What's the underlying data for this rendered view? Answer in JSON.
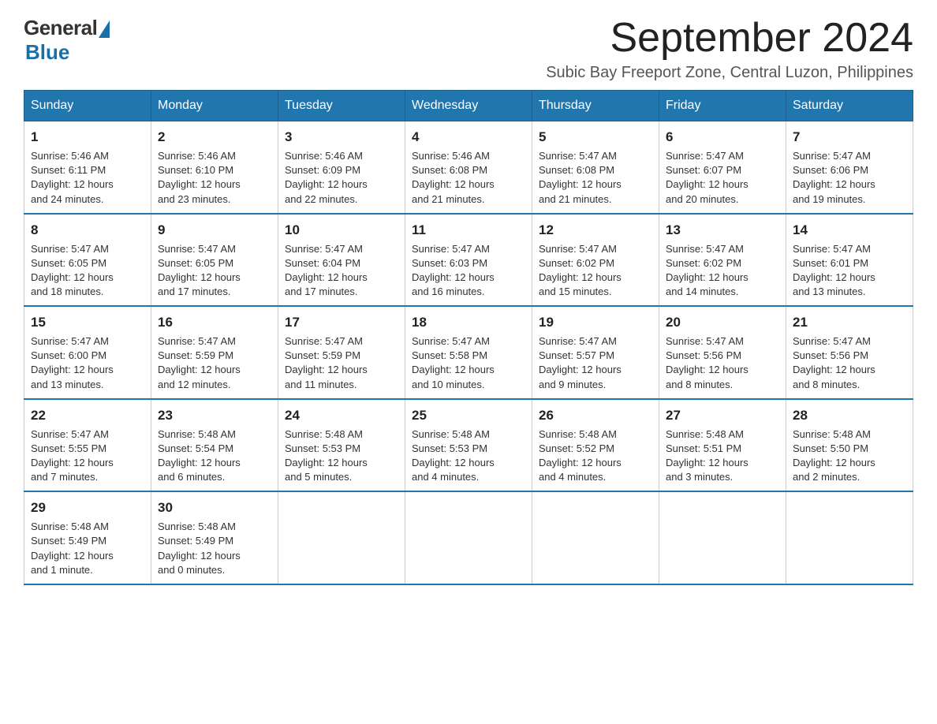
{
  "logo": {
    "general": "General",
    "blue": "Blue"
  },
  "title": "September 2024",
  "subtitle": "Subic Bay Freeport Zone, Central Luzon, Philippines",
  "days_of_week": [
    "Sunday",
    "Monday",
    "Tuesday",
    "Wednesday",
    "Thursday",
    "Friday",
    "Saturday"
  ],
  "weeks": [
    [
      {
        "day": "1",
        "sunrise": "5:46 AM",
        "sunset": "6:11 PM",
        "daylight": "12 hours and 24 minutes."
      },
      {
        "day": "2",
        "sunrise": "5:46 AM",
        "sunset": "6:10 PM",
        "daylight": "12 hours and 23 minutes."
      },
      {
        "day": "3",
        "sunrise": "5:46 AM",
        "sunset": "6:09 PM",
        "daylight": "12 hours and 22 minutes."
      },
      {
        "day": "4",
        "sunrise": "5:46 AM",
        "sunset": "6:08 PM",
        "daylight": "12 hours and 21 minutes."
      },
      {
        "day": "5",
        "sunrise": "5:47 AM",
        "sunset": "6:08 PM",
        "daylight": "12 hours and 21 minutes."
      },
      {
        "day": "6",
        "sunrise": "5:47 AM",
        "sunset": "6:07 PM",
        "daylight": "12 hours and 20 minutes."
      },
      {
        "day": "7",
        "sunrise": "5:47 AM",
        "sunset": "6:06 PM",
        "daylight": "12 hours and 19 minutes."
      }
    ],
    [
      {
        "day": "8",
        "sunrise": "5:47 AM",
        "sunset": "6:05 PM",
        "daylight": "12 hours and 18 minutes."
      },
      {
        "day": "9",
        "sunrise": "5:47 AM",
        "sunset": "6:05 PM",
        "daylight": "12 hours and 17 minutes."
      },
      {
        "day": "10",
        "sunrise": "5:47 AM",
        "sunset": "6:04 PM",
        "daylight": "12 hours and 17 minutes."
      },
      {
        "day": "11",
        "sunrise": "5:47 AM",
        "sunset": "6:03 PM",
        "daylight": "12 hours and 16 minutes."
      },
      {
        "day": "12",
        "sunrise": "5:47 AM",
        "sunset": "6:02 PM",
        "daylight": "12 hours and 15 minutes."
      },
      {
        "day": "13",
        "sunrise": "5:47 AM",
        "sunset": "6:02 PM",
        "daylight": "12 hours and 14 minutes."
      },
      {
        "day": "14",
        "sunrise": "5:47 AM",
        "sunset": "6:01 PM",
        "daylight": "12 hours and 13 minutes."
      }
    ],
    [
      {
        "day": "15",
        "sunrise": "5:47 AM",
        "sunset": "6:00 PM",
        "daylight": "12 hours and 13 minutes."
      },
      {
        "day": "16",
        "sunrise": "5:47 AM",
        "sunset": "5:59 PM",
        "daylight": "12 hours and 12 minutes."
      },
      {
        "day": "17",
        "sunrise": "5:47 AM",
        "sunset": "5:59 PM",
        "daylight": "12 hours and 11 minutes."
      },
      {
        "day": "18",
        "sunrise": "5:47 AM",
        "sunset": "5:58 PM",
        "daylight": "12 hours and 10 minutes."
      },
      {
        "day": "19",
        "sunrise": "5:47 AM",
        "sunset": "5:57 PM",
        "daylight": "12 hours and 9 minutes."
      },
      {
        "day": "20",
        "sunrise": "5:47 AM",
        "sunset": "5:56 PM",
        "daylight": "12 hours and 8 minutes."
      },
      {
        "day": "21",
        "sunrise": "5:47 AM",
        "sunset": "5:56 PM",
        "daylight": "12 hours and 8 minutes."
      }
    ],
    [
      {
        "day": "22",
        "sunrise": "5:47 AM",
        "sunset": "5:55 PM",
        "daylight": "12 hours and 7 minutes."
      },
      {
        "day": "23",
        "sunrise": "5:48 AM",
        "sunset": "5:54 PM",
        "daylight": "12 hours and 6 minutes."
      },
      {
        "day": "24",
        "sunrise": "5:48 AM",
        "sunset": "5:53 PM",
        "daylight": "12 hours and 5 minutes."
      },
      {
        "day": "25",
        "sunrise": "5:48 AM",
        "sunset": "5:53 PM",
        "daylight": "12 hours and 4 minutes."
      },
      {
        "day": "26",
        "sunrise": "5:48 AM",
        "sunset": "5:52 PM",
        "daylight": "12 hours and 4 minutes."
      },
      {
        "day": "27",
        "sunrise": "5:48 AM",
        "sunset": "5:51 PM",
        "daylight": "12 hours and 3 minutes."
      },
      {
        "day": "28",
        "sunrise": "5:48 AM",
        "sunset": "5:50 PM",
        "daylight": "12 hours and 2 minutes."
      }
    ],
    [
      {
        "day": "29",
        "sunrise": "5:48 AM",
        "sunset": "5:49 PM",
        "daylight": "12 hours and 1 minute."
      },
      {
        "day": "30",
        "sunrise": "5:48 AM",
        "sunset": "5:49 PM",
        "daylight": "12 hours and 0 minutes."
      },
      null,
      null,
      null,
      null,
      null
    ]
  ],
  "labels": {
    "sunrise": "Sunrise:",
    "sunset": "Sunset:",
    "daylight": "Daylight:"
  }
}
